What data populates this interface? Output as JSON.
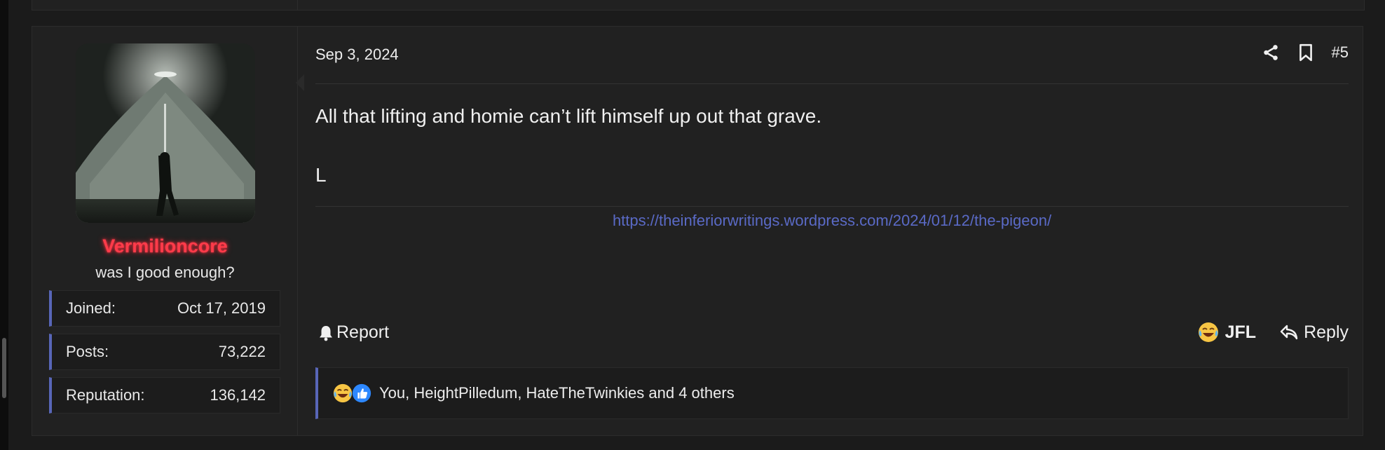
{
  "post": {
    "date": "Sep 3, 2024",
    "number": "#5",
    "body_lines": [
      "All that lifting and homie can’t lift himself up out that grave.",
      "L"
    ],
    "signature_link": "https://theinferiorwritings.wordpress.com/2024/01/12/the-pigeon/"
  },
  "user": {
    "name": "Vermilioncore",
    "name_color": "#ff3b4a",
    "title": "was I good enough?",
    "stats": [
      {
        "label": "Joined:",
        "value": "Oct 17, 2019"
      },
      {
        "label": "Posts:",
        "value": "73,222"
      },
      {
        "label": "Reputation:",
        "value": "136,142"
      }
    ]
  },
  "actions": {
    "report": "Report",
    "jfl": "JFL",
    "reply": "Reply"
  },
  "reactions": {
    "text": "You, HeightPilledum, HateTheTwinkies and 4 others",
    "icons": [
      "crying-laughing-emoji-icon",
      "thumbs-up-icon"
    ]
  },
  "colors": {
    "accent": "#5866b8",
    "link": "#5a6ac6",
    "background": "#212121",
    "page_background": "#1b1b1b"
  },
  "icons": {
    "share": "share-icon",
    "bookmark": "bookmark-icon",
    "report": "bell-icon",
    "reply": "reply-arrow-icon"
  }
}
